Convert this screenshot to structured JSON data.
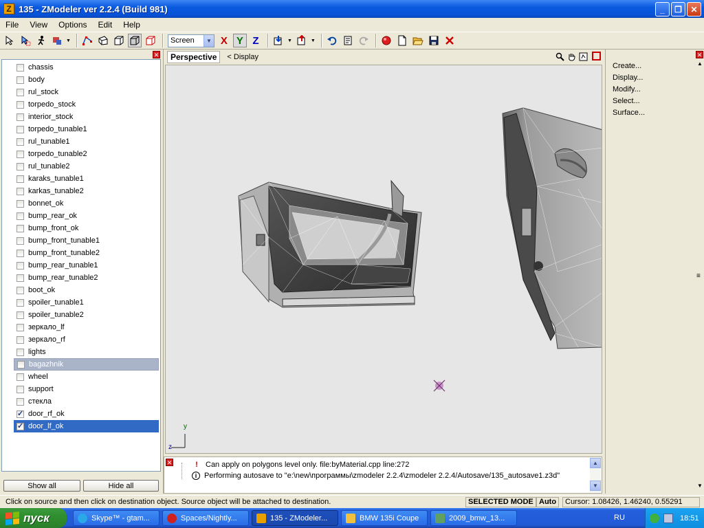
{
  "window": {
    "title": "135 - ZModeler ver 2.2.4 (Build 981)",
    "app_icon_letter": "Z",
    "controls": {
      "minimize": "_",
      "maximize": "❐",
      "close": "✕"
    }
  },
  "menu": [
    "File",
    "View",
    "Options",
    "Edit",
    "Help"
  ],
  "toolbar": {
    "coord_system": "Screen",
    "axes": [
      "X",
      "Y",
      "Z"
    ]
  },
  "objects": {
    "items": [
      {
        "label": "chassis",
        "checked": false,
        "state": ""
      },
      {
        "label": "body",
        "checked": false,
        "state": ""
      },
      {
        "label": "rul_stock",
        "checked": false,
        "state": ""
      },
      {
        "label": "torpedo_stock",
        "checked": false,
        "state": ""
      },
      {
        "label": "interior_stock",
        "checked": false,
        "state": ""
      },
      {
        "label": "torpedo_tunable1",
        "checked": false,
        "state": ""
      },
      {
        "label": "rul_tunable1",
        "checked": false,
        "state": ""
      },
      {
        "label": "torpedo_tunable2",
        "checked": false,
        "state": ""
      },
      {
        "label": "rul_tunable2",
        "checked": false,
        "state": ""
      },
      {
        "label": "karaks_tunable1",
        "checked": false,
        "state": ""
      },
      {
        "label": "karkas_tunable2",
        "checked": false,
        "state": ""
      },
      {
        "label": "bonnet_ok",
        "checked": false,
        "state": ""
      },
      {
        "label": "bump_rear_ok",
        "checked": false,
        "state": ""
      },
      {
        "label": "bump_front_ok",
        "checked": false,
        "state": ""
      },
      {
        "label": "bump_front_tunable1",
        "checked": false,
        "state": ""
      },
      {
        "label": "bump_front_tunable2",
        "checked": false,
        "state": ""
      },
      {
        "label": "bump_rear_tunable1",
        "checked": false,
        "state": ""
      },
      {
        "label": "bump_rear_tunable2",
        "checked": false,
        "state": ""
      },
      {
        "label": "boot_ok",
        "checked": false,
        "state": ""
      },
      {
        "label": "spoiler_tunable1",
        "checked": false,
        "state": ""
      },
      {
        "label": "spoiler_tunable2",
        "checked": false,
        "state": ""
      },
      {
        "label": "зеркало_lf",
        "checked": false,
        "state": ""
      },
      {
        "label": "зеркало_rf",
        "checked": false,
        "state": ""
      },
      {
        "label": "lights",
        "checked": false,
        "state": ""
      },
      {
        "label": "bagazhnik",
        "checked": false,
        "state": "sel-gray"
      },
      {
        "label": "wheel",
        "checked": false,
        "state": ""
      },
      {
        "label": "support",
        "checked": false,
        "state": ""
      },
      {
        "label": "стекла",
        "checked": false,
        "state": ""
      },
      {
        "label": "door_rf_ok",
        "checked": true,
        "state": ""
      },
      {
        "label": "door_lf_ok",
        "checked": true,
        "state": "sel-blue"
      }
    ],
    "show_all": "Show all",
    "hide_all": "Hide all"
  },
  "viewport": {
    "name": "Perspective",
    "display_toggle": "<  Display",
    "axis_y": "y",
    "axis_z": "z"
  },
  "log": {
    "lines": [
      {
        "icon": "!",
        "text": "Can apply on polygons level only. file:byMaterial.cpp line:272"
      },
      {
        "icon": "i",
        "text": "Performing autosave to \"e:\\new\\программы\\zmodeler 2.2.4\\zmodeler 2.2.4/Autosave/135_autosave1.z3d\""
      }
    ]
  },
  "commands": [
    "Create...",
    "Display...",
    "Modify...",
    "Select...",
    "Surface..."
  ],
  "status": {
    "message": "Click on source and then click on destination object. Source object will be attached to destination.",
    "mode": "SELECTED MODE",
    "auto": "Auto",
    "cursor": "Cursor: 1.08426, 1.46240, 0.55291"
  },
  "taskbar": {
    "start": "пуск",
    "tasks": [
      "Skype™ - gtam...",
      "Spaces/Nightly...",
      "135 - ZModeler...",
      "BMW 135i Coupe",
      "2009_bmw_13..."
    ],
    "lang": "RU",
    "clock": "18:51"
  },
  "colors": {
    "selection_blue": "#316ac5",
    "selection_gray": "#aab4c8",
    "viewport_bg": "#e6e6e6"
  }
}
